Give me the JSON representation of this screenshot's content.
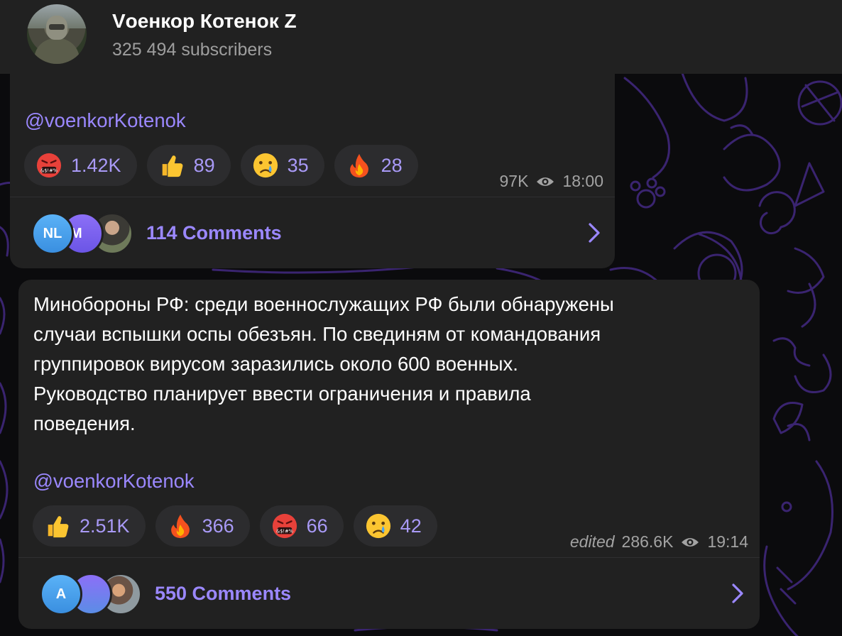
{
  "channel": {
    "title": "Vоенкор Котенок Z",
    "subscribers": "325 494 subscribers"
  },
  "post1": {
    "signature": "@voenkorKotenok",
    "reactions": [
      {
        "emoji": "angry-face-icon",
        "count": "1.42K"
      },
      {
        "emoji": "thumbs-up-icon",
        "count": "89"
      },
      {
        "emoji": "crying-face-icon",
        "count": "35"
      },
      {
        "emoji": "fire-icon",
        "count": "28"
      }
    ],
    "views": "97K",
    "time": "18:00",
    "comments": {
      "avatars": [
        "NL",
        "M",
        ""
      ],
      "label": "114 Comments"
    }
  },
  "post2": {
    "text": "Минобороны РФ: среди военнослужащих РФ были обнаружены\nслучаи вспышки оспы обезъян. По свединям от командования\nгруппировок вирусом заразились около 600 военных.\nРуководство планирует ввести ограничения и правила\nповедения.",
    "signature": "@voenkorKotenok",
    "reactions": [
      {
        "emoji": "thumbs-up-icon",
        "count": "2.51K"
      },
      {
        "emoji": "fire-icon",
        "count": "366"
      },
      {
        "emoji": "angry-face-icon",
        "count": "66"
      },
      {
        "emoji": "crying-face-icon",
        "count": "42"
      }
    ],
    "edited": "edited",
    "views": "286.6K",
    "time": "19:14",
    "comments": {
      "avatars": [
        "A",
        "",
        ""
      ],
      "label": "550 Comments"
    }
  },
  "colors": {
    "accent": "#9b88ff",
    "bubble": "#212121",
    "chip": "#2c2c2e",
    "background": "#0b0b0d",
    "pattern": "#3b1e6e"
  }
}
